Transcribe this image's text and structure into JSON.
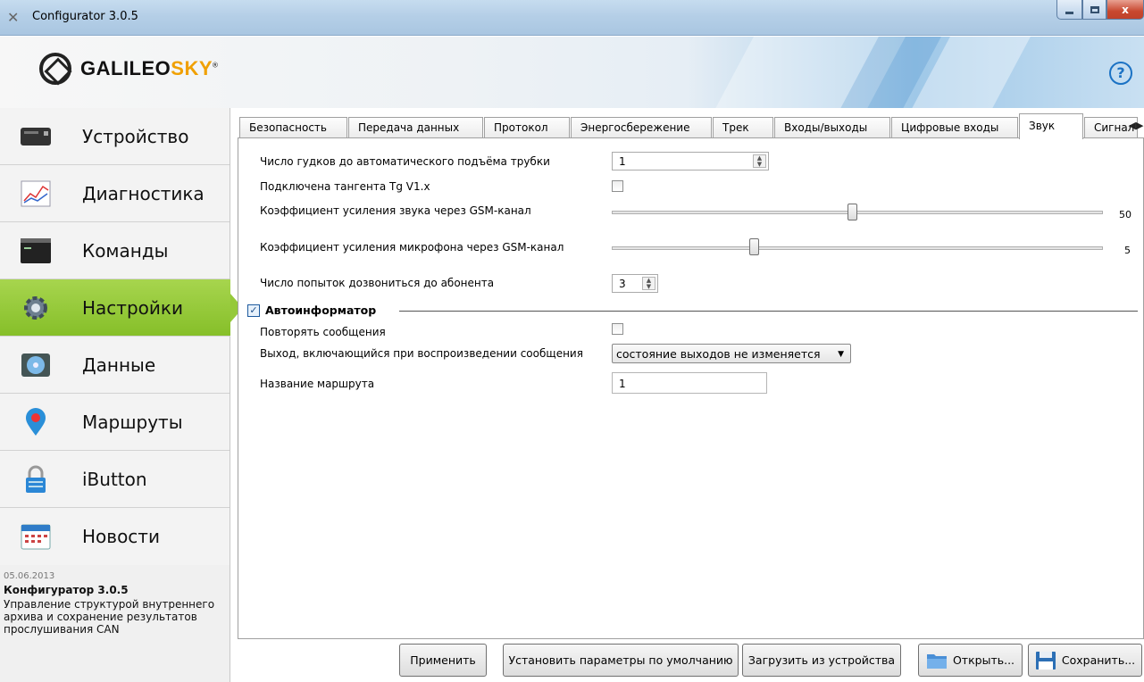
{
  "window": {
    "title": "Configurator 3.0.5",
    "close_symbol": "x"
  },
  "banner": {
    "logo_main": "GALILEO",
    "logo_accent": "SKY",
    "logo_mark": "®",
    "help_symbol": "?"
  },
  "sidebar": {
    "items": [
      {
        "label": "Устройство",
        "icon": "device-icon"
      },
      {
        "label": "Диагностика",
        "icon": "chart-icon"
      },
      {
        "label": "Команды",
        "icon": "terminal-icon"
      },
      {
        "label": "Настройки",
        "icon": "gear-icon",
        "active": true
      },
      {
        "label": "Данные",
        "icon": "disk-icon"
      },
      {
        "label": "Маршруты",
        "icon": "map-pin-icon"
      },
      {
        "label": "iButton",
        "icon": "lock-icon"
      },
      {
        "label": "Новости",
        "icon": "calendar-icon"
      }
    ],
    "news": {
      "date": "05.06.2013",
      "title": "Конфигуратор 3.0.5",
      "text": "Управление структурой внутреннего архива и сохранение результатов прослушивания CAN"
    }
  },
  "tabs": [
    {
      "label": "Безопасность"
    },
    {
      "label": "Передача данных"
    },
    {
      "label": "Протокол"
    },
    {
      "label": "Энергосбережение"
    },
    {
      "label": "Трек"
    },
    {
      "label": "Входы/выходы"
    },
    {
      "label": "Цифровые входы"
    },
    {
      "label": "Звук",
      "active": true
    },
    {
      "label": "Сигнал"
    }
  ],
  "sound": {
    "rings_label": "Число гудков до автоматического подъёма трубки",
    "rings_value": "1",
    "tangent_label": "Подключена тангента Tg V1.x",
    "tangent_checked": false,
    "gsm_gain_label": "Коэффициент усиления звука через GSM-канал",
    "gsm_gain_value": 50,
    "gsm_gain_fraction": 0.49,
    "mic_gain_label": "Коэффициент усиления микрофона через GSM-канал",
    "mic_gain_value": 5,
    "mic_gain_fraction": 0.29,
    "dial_attempts_label": "Число попыток дозвониться до абонента",
    "dial_attempts_value": "3"
  },
  "autoinformer": {
    "label": "Автоинформатор",
    "enabled": true,
    "check_mark": "✓",
    "repeat_label": "Повторять сообщения",
    "repeat_checked": false,
    "output_label": "Выход, включающийся при воспроизведении сообщения",
    "output_value": "состояние выходов не изменяется",
    "route_label": "Название маршрута",
    "route_value": "1"
  },
  "buttons": {
    "apply": "Применить",
    "defaults": "Установить параметры по умолчанию",
    "load": "Загрузить из устройства",
    "open": "Открыть...",
    "save": "Сохранить..."
  },
  "colors": {
    "active_nav": "#95c93a",
    "accent_blue": "#1b72c4",
    "logo_accent": "#f0a000"
  }
}
